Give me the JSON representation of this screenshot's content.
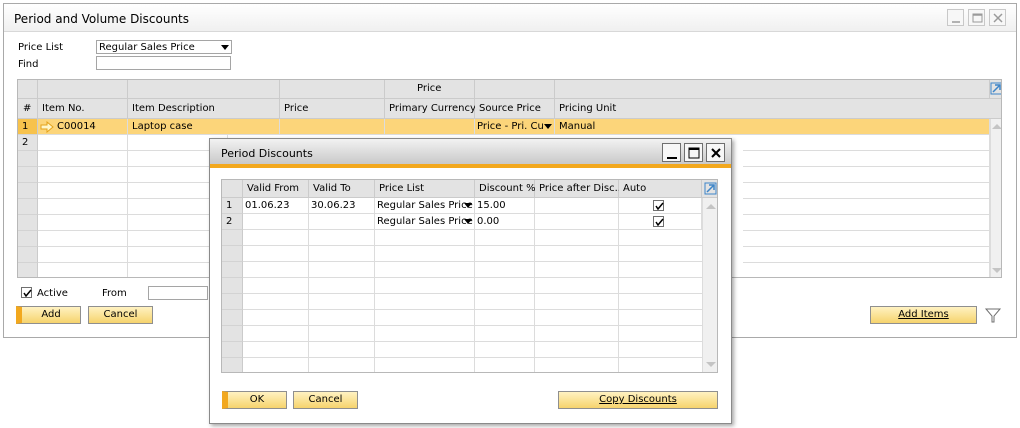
{
  "main": {
    "title": "Period and Volume Discounts",
    "price_list_label": "Price List",
    "price_list_value": "Regular Sales Price",
    "find_label": "Find",
    "find_value": "",
    "grid": {
      "price_group_header": "Price",
      "columns": [
        "#",
        "Item No.",
        "Item Description",
        "Price",
        "Primary Currency",
        "Source Price",
        "Pricing Unit"
      ],
      "rows": [
        {
          "num": "1",
          "item_no": "C00014",
          "description": "Laptop case",
          "price": "",
          "primary_currency": "",
          "source_price": "Price - Pri. Cu",
          "pricing_unit": "Manual"
        },
        {
          "num": "2",
          "item_no": "",
          "description": "",
          "price": "",
          "primary_currency": "",
          "source_price": "",
          "pricing_unit": ""
        }
      ]
    },
    "active_label": "Active",
    "active_checked": true,
    "from_label": "From",
    "from_value": "",
    "add_button": "Add",
    "cancel_button": "Cancel",
    "add_items_button": "Add Items"
  },
  "dialog": {
    "title": "Period Discounts",
    "columns": [
      "Valid From",
      "Valid To",
      "Price List",
      "Discount %",
      "Price after Disc...",
      "Auto"
    ],
    "rows": [
      {
        "num": "1",
        "valid_from": "01.06.23",
        "valid_to": "30.06.23",
        "price_list": "Regular Sales Price",
        "discount": "15.00",
        "price_after": "",
        "auto": true
      },
      {
        "num": "2",
        "valid_from": "",
        "valid_to": "",
        "price_list": "Regular Sales Price",
        "discount": "0.00",
        "price_after": "",
        "auto": true
      }
    ],
    "ok_button": "OK",
    "cancel_button": "Cancel",
    "copy_discounts_button": "Copy Discounts"
  },
  "colors": {
    "accent_orange": "#f2a81e",
    "selected_row": "#fcd57a",
    "button_fill": "#f6d36d"
  }
}
